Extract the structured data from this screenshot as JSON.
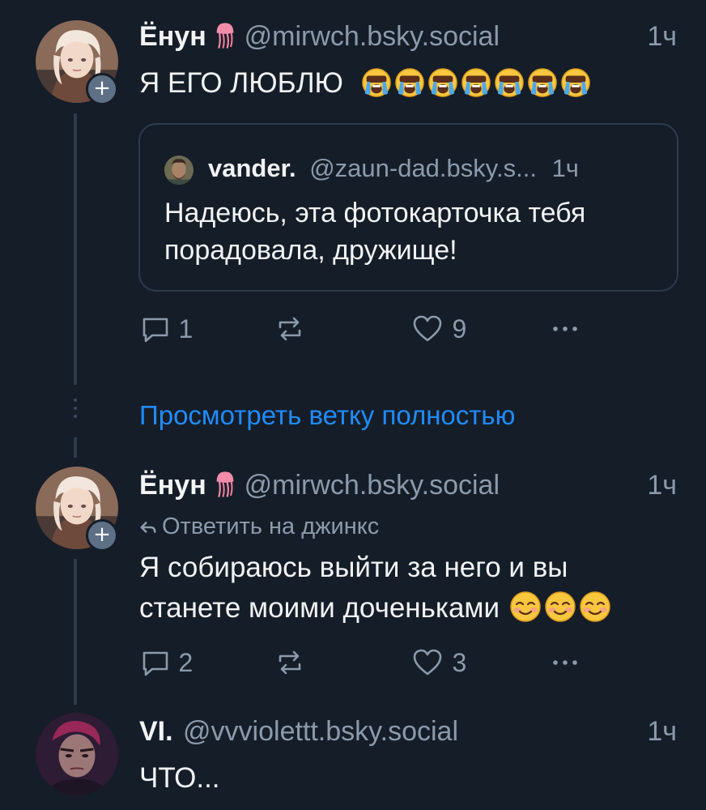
{
  "post1": {
    "author": "Ёнун",
    "handle": "@mirwch.bsky.social",
    "time": "1ч",
    "text": "Я ЕГО ЛЮБЛЮ",
    "emoji_count": 7,
    "quote": {
      "author": "vander.",
      "handle": "@zaun-dad.bsky.s...",
      "time": "1ч",
      "line1": "Надеюсь, эта фотокарточка тебя",
      "line2": "порадовала, дружище!"
    },
    "replies": "1",
    "likes": "9"
  },
  "thread_link": "Просмотреть ветку полностью",
  "post2": {
    "author": "Ёнун",
    "handle": "@mirwch.bsky.social",
    "time": "1ч",
    "reply_to": "Ответить на джинкс",
    "line1": "Я собираюсь выйти за него и вы",
    "line2": "станете моими доченьками",
    "emoji_count": 3,
    "replies": "2",
    "likes": "3"
  },
  "post3": {
    "author": "VI.",
    "handle": "@vvviolettt.bsky.social",
    "time": "1ч",
    "text": "ЧТО..."
  },
  "colors": {
    "background": "#151d28",
    "text": "#f1f3f5",
    "muted": "#8c9aab",
    "link": "#208bfe",
    "thread_line": "#2e3b4b"
  }
}
